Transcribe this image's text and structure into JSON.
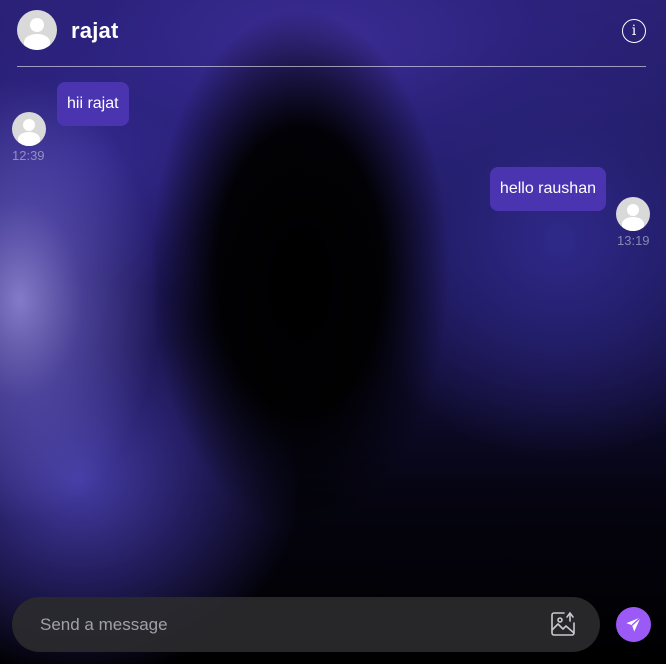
{
  "header": {
    "contact_name": "rajat",
    "avatar_icon": "user-avatar-icon",
    "info_icon_glyph": "i"
  },
  "messages": [
    {
      "text": "hii rajat",
      "time": "12:39",
      "direction": "incoming"
    },
    {
      "text": "hello raushan",
      "time": "13:19",
      "direction": "outgoing"
    }
  ],
  "composer": {
    "placeholder": "Send a message",
    "value": "",
    "image_icon": "image-icon",
    "send_icon": "send-icon"
  },
  "colors": {
    "bubble": "#4a34b0",
    "send_button": "#9b59f6",
    "composer_bg": "#2a2a2e",
    "header_divider": "#ffffff"
  }
}
